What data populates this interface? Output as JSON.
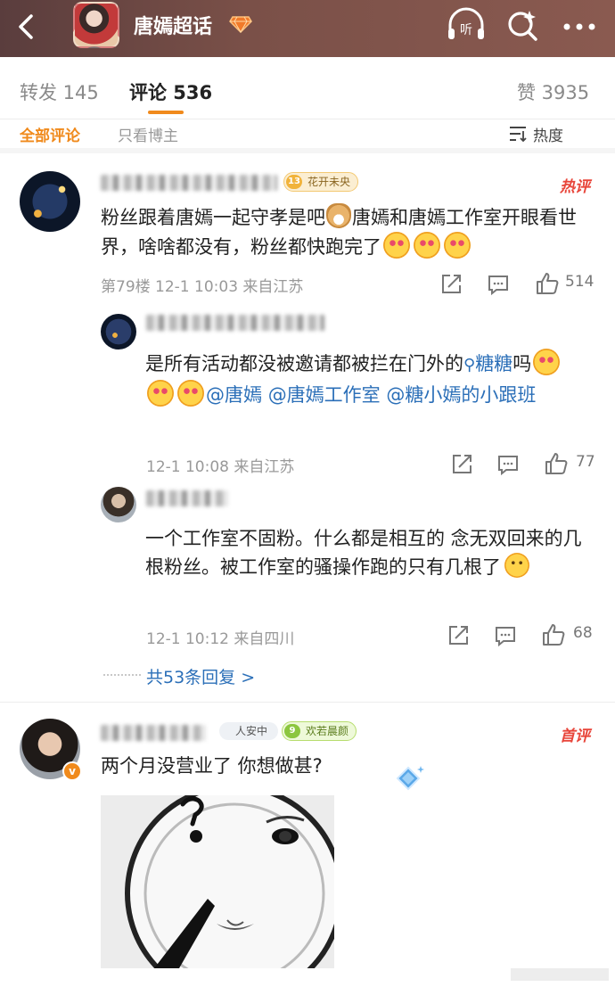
{
  "header": {
    "title": "唐嫣超话",
    "listen_label": "听"
  },
  "tabs": {
    "repost": "转发 145",
    "comments": "评论 536",
    "likes": "赞 3935"
  },
  "filters": {
    "all": "全部评论",
    "owner_only": "只看博主",
    "sort": "热度"
  },
  "comments": [
    {
      "badge_level": "13",
      "badge_label": "花开未央",
      "tag": "热评",
      "text_a": "粉丝跟着唐嫣一起守孝是吧",
      "text_b": "唐嫣和唐嫣工作室开眼看世界，啥啥都没有，粉丝都快跑完了",
      "meta": "第79楼 12-1 10:03 来自江苏",
      "likes": "514"
    }
  ],
  "replies": [
    {
      "text": "是所有活动都没被邀请都被拦在门外的",
      "link_search": "糖糖",
      "text_tail": "吗",
      "mention_1": "@唐嫣",
      "mention_2": "@唐嫣工作室",
      "mention_3": "@糖小嫣的小跟班",
      "meta": "12-1 10:08 来自江苏",
      "likes": "77"
    },
    {
      "text": "一个工作室不固粉。什么都是相互的 念无双回来的几根粉丝。被工作室的骚操作跑的只有几根了",
      "meta": "12-1 10:12 来自四川",
      "likes": "68"
    }
  ],
  "more_replies": "共53条回复 >",
  "second_comment": {
    "wealth_badge": "人安中",
    "badge_level": "9",
    "badge_label": "欢若晨颜",
    "tag": "首评",
    "text": "两个月没营业了 你想做甚?"
  },
  "icons": {
    "back": "back-arrow-icon",
    "listen": "headphones-icon",
    "search": "search-sparkle-icon",
    "more": "more-dots-icon",
    "sort": "sort-icon",
    "share": "share-icon",
    "comment": "comment-icon",
    "like": "thumbs-up-icon"
  },
  "colors": {
    "accent": "#f08a1c",
    "link": "#2b6fb8",
    "hot": "#e8453a"
  }
}
